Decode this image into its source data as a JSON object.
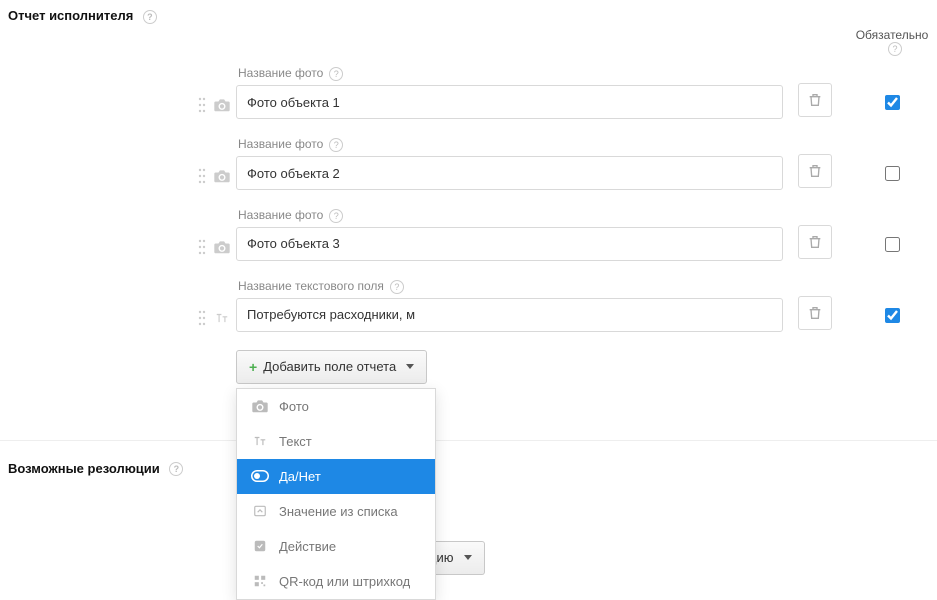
{
  "section1": {
    "title": "Отчет исполнителя",
    "required_header": "Обязательно"
  },
  "fields": [
    {
      "type": "photo",
      "label": "Название фото",
      "value": "Фото объекта 1",
      "required": true
    },
    {
      "type": "photo",
      "label": "Название фото",
      "value": "Фото объекта 2",
      "required": false
    },
    {
      "type": "photo",
      "label": "Название фото",
      "value": "Фото объекта 3",
      "required": false
    },
    {
      "type": "text",
      "label": "Название текстового поля",
      "value": "Потребуются расходники, м",
      "required": true
    }
  ],
  "add_button": "Добавить поле отчета",
  "dropdown": {
    "items": [
      {
        "icon": "camera",
        "label": "Фото"
      },
      {
        "icon": "text",
        "label": "Текст"
      },
      {
        "icon": "toggle",
        "label": "Да/Нет"
      },
      {
        "icon": "list",
        "label": "Значение из списка"
      },
      {
        "icon": "check",
        "label": "Действие"
      },
      {
        "icon": "qr",
        "label": "QR-код или штрихкод"
      }
    ],
    "selected_index": 2
  },
  "section2": {
    "title": "Возможные резолюции"
  },
  "resolution_button_fragment": "езолюцию"
}
